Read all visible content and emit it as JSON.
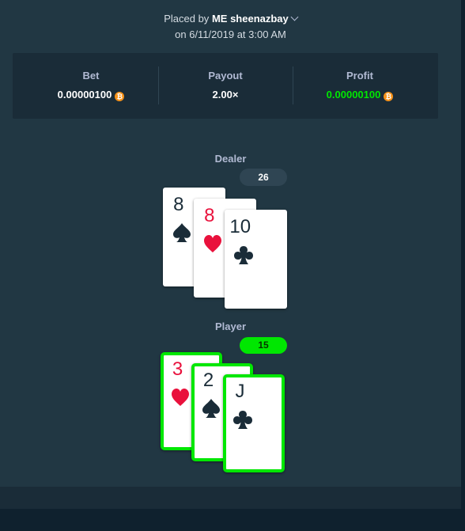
{
  "placed": {
    "prefix": "Placed by",
    "me": "ME",
    "username": "sheenazbay",
    "date_line": "on 6/11/2019 at 3:00 AM"
  },
  "stats": {
    "bet_label": "Bet",
    "bet_value": "0.00000100",
    "payout_label": "Payout",
    "payout_value": "2.00×",
    "profit_label": "Profit",
    "profit_value": "0.00000100"
  },
  "currency_icon": "bitcoin-icon",
  "colors": {
    "win": "#00e701",
    "accent": "#f7931a",
    "red_suit": "#e9113c",
    "panel": "#213743"
  },
  "dealer": {
    "label": "Dealer",
    "total": "26",
    "cards": [
      {
        "rank": "8",
        "suit": "spade"
      },
      {
        "rank": "8",
        "suit": "heart"
      },
      {
        "rank": "10",
        "suit": "club"
      }
    ]
  },
  "player": {
    "label": "Player",
    "total": "15",
    "cards": [
      {
        "rank": "3",
        "suit": "heart"
      },
      {
        "rank": "2",
        "suit": "spade"
      },
      {
        "rank": "J",
        "suit": "club"
      }
    ]
  }
}
